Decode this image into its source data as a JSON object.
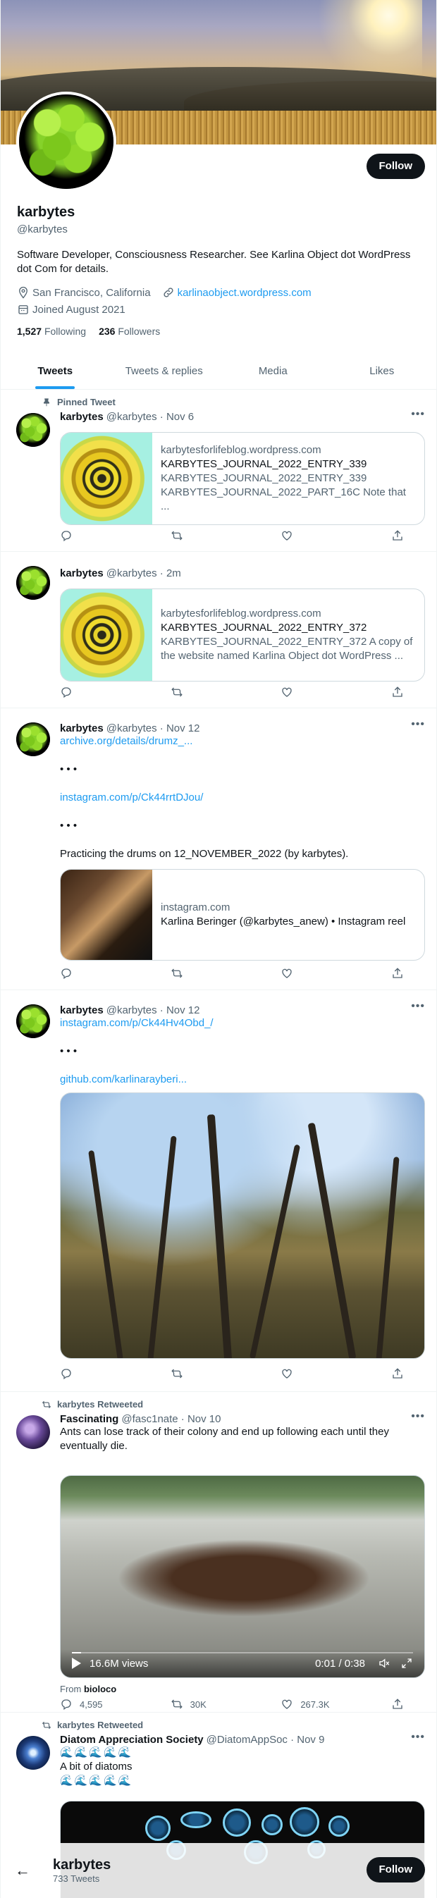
{
  "profile": {
    "display_name": "karbytes",
    "handle": "@karbytes",
    "bio": "Software Developer, Consciousness Researcher. See Karlina Object dot WordPress dot Com for details.",
    "location": "San Francisco, California",
    "website": "karlinaobject.wordpress.com",
    "joined": "Joined August 2021",
    "following_count": "1,527",
    "following_label": "Following",
    "followers_count": "236",
    "followers_label": "Followers",
    "follow_label": "Follow"
  },
  "tabs": [
    {
      "label": "Tweets"
    },
    {
      "label": "Tweets & replies"
    },
    {
      "label": "Media"
    },
    {
      "label": "Likes"
    }
  ],
  "tweets": [
    {
      "context": "Pinned Tweet",
      "name": "karbytes",
      "meta": "@karbytes · Nov 6",
      "card": {
        "domain": "karbytesforlifeblog.wordpress.com",
        "title": "KARBYTES_JOURNAL_2022_ENTRY_339",
        "desc1": "KARBYTES_JOURNAL_2022_ENTRY_339",
        "desc2": "KARBYTES_JOURNAL_2022_PART_16C Note that ..."
      }
    },
    {
      "name": "karbytes",
      "meta": "@karbytes · 2m",
      "card": {
        "domain": "karbytesforlifeblog.wordpress.com",
        "title": "KARBYTES_JOURNAL_2022_ENTRY_372",
        "desc1": "KARBYTES_JOURNAL_2022_ENTRY_372 A copy of",
        "desc2": "the website named Karlina Object dot WordPress ..."
      }
    },
    {
      "name": "karbytes",
      "meta": "@karbytes · Nov 12",
      "link1": "archive.org/details/drumz_...",
      "dots1": "• • •",
      "link2": "instagram.com/p/Ck44rrtDJou/",
      "dots2": "• • •",
      "text": "Practicing the drums on 12_NOVEMBER_2022 (by karbytes).",
      "card": {
        "domain": "instagram.com",
        "title": "Karlina Beringer (@karbytes_anew) • Instagram reel"
      }
    },
    {
      "name": "karbytes",
      "meta": "@karbytes · Nov 12",
      "link1": "instagram.com/p/Ck44Hv4Obd_/",
      "dots1": "• • •",
      "link2": "github.com/karlinarayberi..."
    },
    {
      "context": "karbytes Retweeted",
      "name": "Fascinating",
      "meta": "@fasc1nate · Nov 10",
      "text": "Ants can lose track of their colony and end up following each until they eventually die.",
      "video": {
        "views": "16.6M views",
        "time": "0:01 / 0:38",
        "progress": 0.026
      },
      "from_label": "From",
      "from_source": "bioloco",
      "stats": {
        "replies": "4,595",
        "retweets": "30K",
        "likes": "267.3K"
      }
    },
    {
      "context": "karbytes Retweeted",
      "name": "Diatom Appreciation Society",
      "meta": "@DiatomAppSoc · Nov 9",
      "waves": "🌊🌊🌊🌊🌊",
      "text": "A bit of diatoms",
      "waves2": "🌊🌊🌊🌊🌊"
    }
  ],
  "bottom_bar": {
    "name": "karbytes",
    "tweet_count": "733 Tweets",
    "follow_label": "Follow"
  },
  "icons": [
    "pin-icon",
    "location-icon",
    "link-icon",
    "calendar-icon",
    "reply-icon",
    "retweet-icon",
    "like-icon",
    "share-icon",
    "more-icon",
    "back-arrow-icon",
    "mute-icon",
    "fullscreen-icon"
  ],
  "colors": {
    "accent": "#1d9bf0",
    "text": "#0f1419",
    "muted": "#536471"
  }
}
